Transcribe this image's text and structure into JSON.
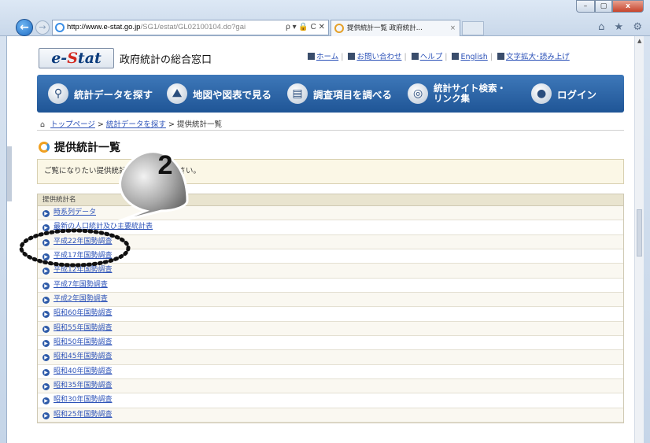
{
  "browser": {
    "address_domain": "http://www.e-stat.go.jp",
    "address_rest": "/SG1/estat/GL02100104.do?gai",
    "address_tools": "ρ ▾ 🔒 C ✕",
    "tab_title": "提供統計一覧 政府統計...",
    "tab_close": "×",
    "back_icon": "back-arrow-icon",
    "toolbar_icons": "⌂ ★ ⚙"
  },
  "header": {
    "logo_e": "e-",
    "logo_s": "S",
    "logo_rest": "tat",
    "site_name": "政府統計の総合窓口",
    "utils": [
      "ホーム",
      "お問い合わせ",
      "ヘルプ",
      "English",
      "文字拡大･読み上げ"
    ]
  },
  "nav": {
    "items": [
      {
        "label": "統計データを探す",
        "icon": "search-icon"
      },
      {
        "label": "地図や図表で見る",
        "icon": "map-icon"
      },
      {
        "label": "調査項目を調べる",
        "icon": "document-search-icon"
      },
      {
        "label_line1": "統計サイト検索・",
        "label_line2": "リンク集",
        "icon": "globe-icon"
      },
      {
        "label": "ログイン",
        "icon": "user-icon"
      }
    ]
  },
  "breadcrumb": {
    "top": "トップページ",
    "search": "統計データを探す",
    "current": "提供統計一覧",
    "sep": ">"
  },
  "page": {
    "title": "提供統計一覧",
    "notice": "ご覧になりたい提供統計を選択してください。"
  },
  "list": {
    "header": "提供統計名",
    "items": [
      "時系列データ",
      "最新の人口統計及び主要統計表",
      "平成22年国勢調査",
      "平成17年国勢調査",
      "平成12年国勢調査",
      "平成7年国勢調査",
      "平成2年国勢調査",
      "昭和60年国勢調査",
      "昭和55年国勢調査",
      "昭和50年国勢調査",
      "昭和45年国勢調査",
      "昭和40年国勢調査",
      "昭和35年国勢調査",
      "昭和30年国勢調査",
      "昭和25年国勢調査"
    ]
  },
  "annotation": {
    "step_number": "2",
    "colors": {
      "bubble": "#7a7a7a",
      "ring": "#111111"
    }
  }
}
